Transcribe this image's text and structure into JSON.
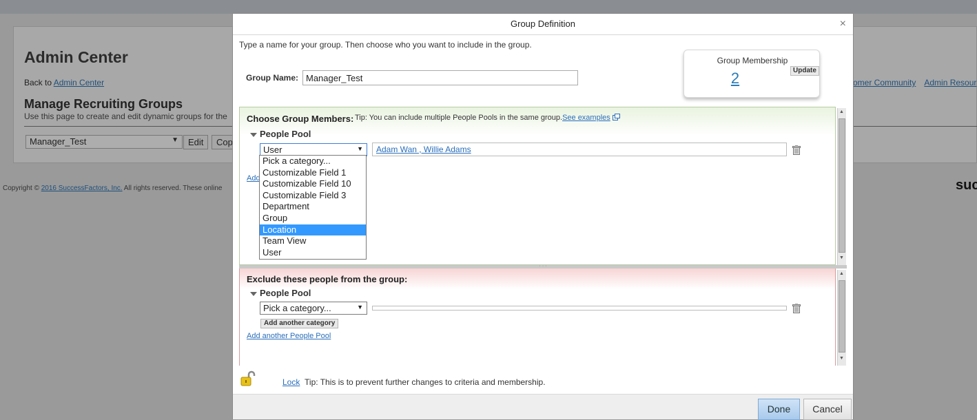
{
  "background": {
    "title": "Admin Center",
    "back_prefix": "Back to ",
    "back_link": "Admin Center",
    "heading": "Manage Recruiting Groups",
    "description": "Use this page to create and edit dynamic groups for the",
    "group_select_value": "Manager_Test",
    "edit_button": "Edit",
    "copy_button": "Cop",
    "right_links": [
      "omer Community",
      "Admin Resour"
    ],
    "copyright_prefix": "Copyright © ",
    "copyright_link": "2016 SuccessFactors, Inc.",
    "copyright_suffix": " All rights reserved. These online",
    "logo_text": "suc"
  },
  "dialog": {
    "title": "Group Definition",
    "close_glyph": "×",
    "intro": "Type a name for your group. Then choose who you want to include in the group.",
    "group_name_label": "Group Name:",
    "group_name_value": "Manager_Test",
    "membership": {
      "title": "Group Membership",
      "count": "2",
      "update_label": "Update"
    },
    "include": {
      "title": "Choose Group Members:",
      "tip": "Tip: You can include multiple People Pools in the same group.",
      "tip_link": "See examples",
      "pool_label": "People Pool",
      "category_value": "User",
      "selected_values": "Adam Wan , Willie Adams",
      "add_link_partial": "Add",
      "dropdown_options": [
        "Pick a category...",
        "Customizable Field 1",
        "Customizable Field 10",
        "Customizable Field 3",
        "Department",
        "Group",
        "Location",
        "Team View",
        "User"
      ],
      "highlighted_option": "Location"
    },
    "exclude": {
      "title": "Exclude these people from the group:",
      "pool_label": "People Pool",
      "category_value": "Pick a category...",
      "add_category_label": "Add another category",
      "add_pool_link": "Add another People Pool"
    },
    "lock": {
      "link": "Lock",
      "tip": "Tip: This is to prevent further changes to criteria and membership."
    },
    "footer": {
      "done_label": "Done",
      "cancel_label": "Cancel"
    }
  },
  "colors": {
    "accent_link": "#2a6ebb",
    "highlight": "#3399ff",
    "include_bg": "#e9f3df",
    "exclude_bg": "#f7d4d4"
  }
}
